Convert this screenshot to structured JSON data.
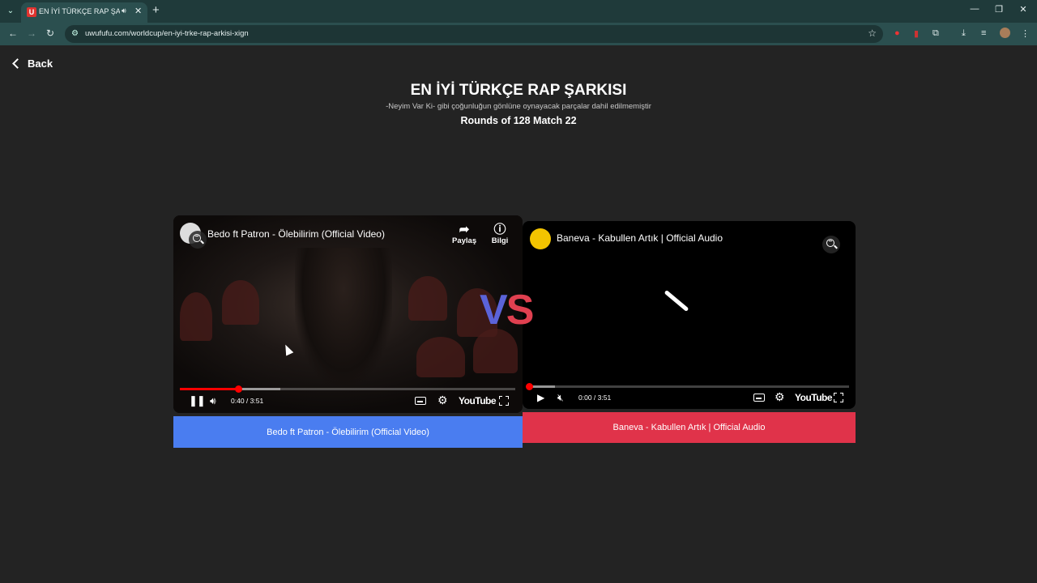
{
  "browser": {
    "tab_title": "EN İYİ TÜRKÇE RAP ŞARKISI",
    "favicon_letter": "U",
    "url": "uwufufu.com/worldcup/en-iyi-trke-rap-arkisi-xign",
    "icons": [
      "tab-menu-icon",
      "speaker-icon",
      "close-icon",
      "plus-icon",
      "back-arrow-icon",
      "forward-arrow-icon",
      "reload-icon",
      "site-info-icon",
      "star-icon",
      "extensions-icon",
      "download-icon",
      "media-icon",
      "profile-avatar",
      "menu-dots-icon",
      "minimize-icon",
      "restore-icon",
      "window-close-icon"
    ]
  },
  "page": {
    "back_label": "Back",
    "title": "EN İYİ TÜRKÇE RAP ŞARKISI",
    "subtitle": "-Neyim Var Ki- gibi çoğunluğun gönlüne oynayacak parçalar dahil edilmemiştir",
    "round": "Rounds of 128 Match 22",
    "vs_v": "V",
    "vs_s": "S"
  },
  "left_video": {
    "title": "Bedo ft Patron - Ölebilirim (Official Video)",
    "share_label": "Paylaş",
    "info_label": "Bilgi",
    "time": "0:40 / 3:51",
    "progress": 0.173,
    "buffered": 0.3,
    "brand": "YouTube",
    "state": "playing",
    "choice_label": "Bedo ft Patron - Ölebilirim (Official Video)",
    "choice_color": "#4a7df0"
  },
  "right_video": {
    "title": "Baneva - Kabullen Artık | Official Audio",
    "time": "0:00 / 3:51",
    "progress": 0.0,
    "buffered": 0.08,
    "brand": "YouTube",
    "state": "paused",
    "muted": true,
    "choice_label": "Baneva - Kabullen Artık | Official Audio",
    "choice_color": "#e0334a"
  }
}
